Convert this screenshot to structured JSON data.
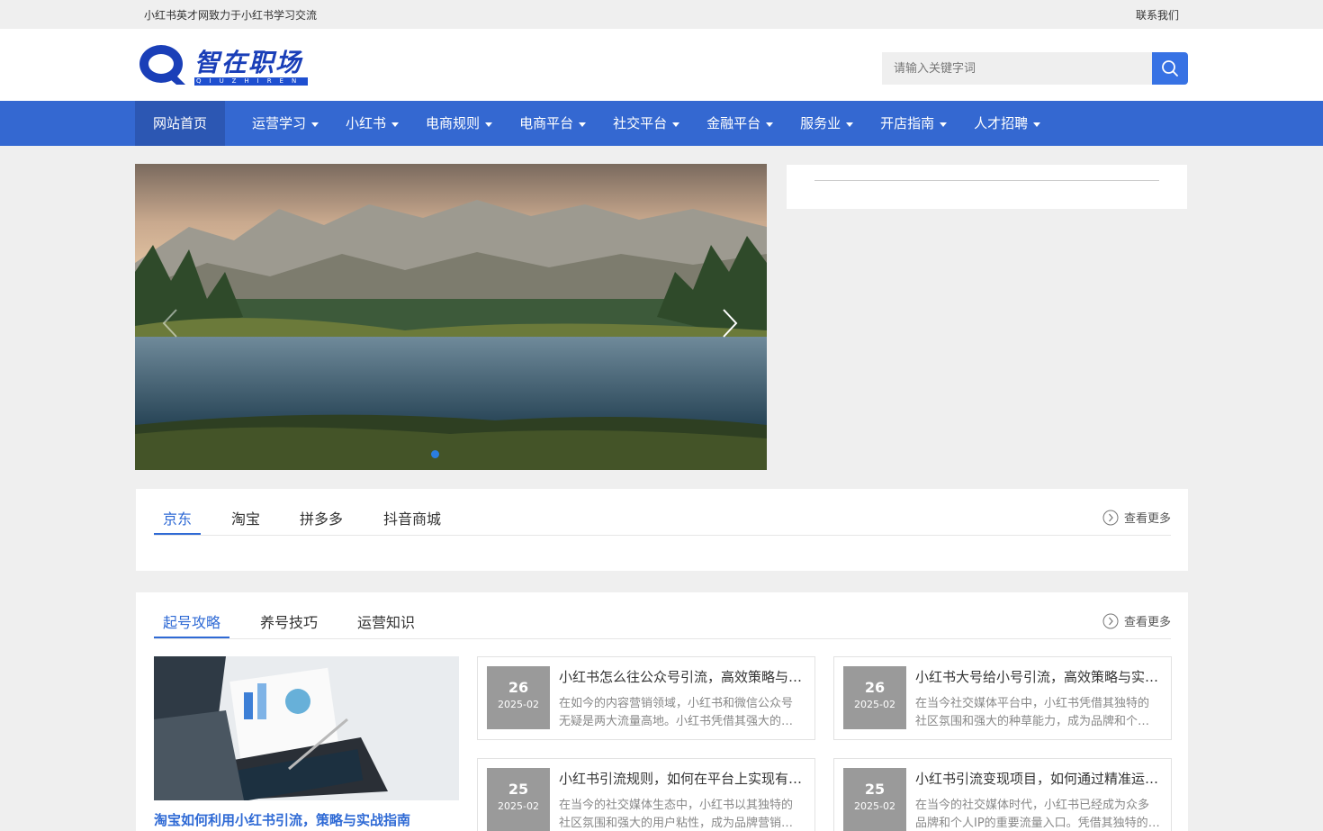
{
  "topbar": {
    "slogan": "小红书英才网致力于小红书学习交流",
    "contact": "联系我们"
  },
  "header": {
    "logo": {
      "text": "智在职场",
      "subtext": "QIUZHIREN",
      "icon": "q-logo-icon"
    },
    "search": {
      "placeholder": "请输入关键字词",
      "icon": "search-icon"
    }
  },
  "nav": {
    "home": "网站首页",
    "items": [
      "运营学习",
      "小红书",
      "电商规则",
      "电商平台",
      "社交平台",
      "金融平台",
      "服务业",
      "开店指南",
      "人才招聘"
    ]
  },
  "banner": {
    "prev_icon": "chevron-left-icon",
    "next_icon": "chevron-right-icon"
  },
  "section1": {
    "tabs": [
      "京东",
      "淘宝",
      "拼多多",
      "抖音商城"
    ],
    "active": 0,
    "more": "查看更多"
  },
  "section2": {
    "tabs": [
      "起号攻略",
      "养号技巧",
      "运营知识"
    ],
    "active": 0,
    "more": "查看更多",
    "featured_title": "淘宝如何利用小红书引流，策略与实战指南",
    "cards": [
      {
        "day": "26",
        "ym": "2025-02",
        "title": "小红书怎么往公众号引流，高效策略与实践技巧",
        "desc": "在如今的内容营销领域，小红书和微信公众号无疑是两大流量高地。小红书凭借其强大的种草能力吸引了大量用户"
      },
      {
        "day": "26",
        "ym": "2025-02",
        "title": "小红书大号给小号引流，高效策略与实操指南",
        "desc": "在当今社交媒体平台中，小红书凭借其独特的社区氛围和强大的种草能力，成为品牌和个人推广的重要阵地"
      },
      {
        "day": "25",
        "ym": "2025-02",
        "title": "小红书引流规则，如何在平台上实现有效引流",
        "desc": "在当今的社交媒体生态中，小红书以其独特的社区氛围和强大的用户粘性，成为品牌营销的重要渠道"
      },
      {
        "day": "25",
        "ym": "2025-02",
        "title": "小红书引流变现项目，如何通过精准运营实现收益",
        "desc": "在当今的社交媒体时代，小红书已经成为众多品牌和个人IP的重要流量入口。凭借其独特的内容生态"
      }
    ]
  },
  "colors": {
    "nav": "#3468d1",
    "nav_active": "#2c57b3",
    "accent": "#2f6ad5",
    "date_box": "#9a9a9a"
  }
}
